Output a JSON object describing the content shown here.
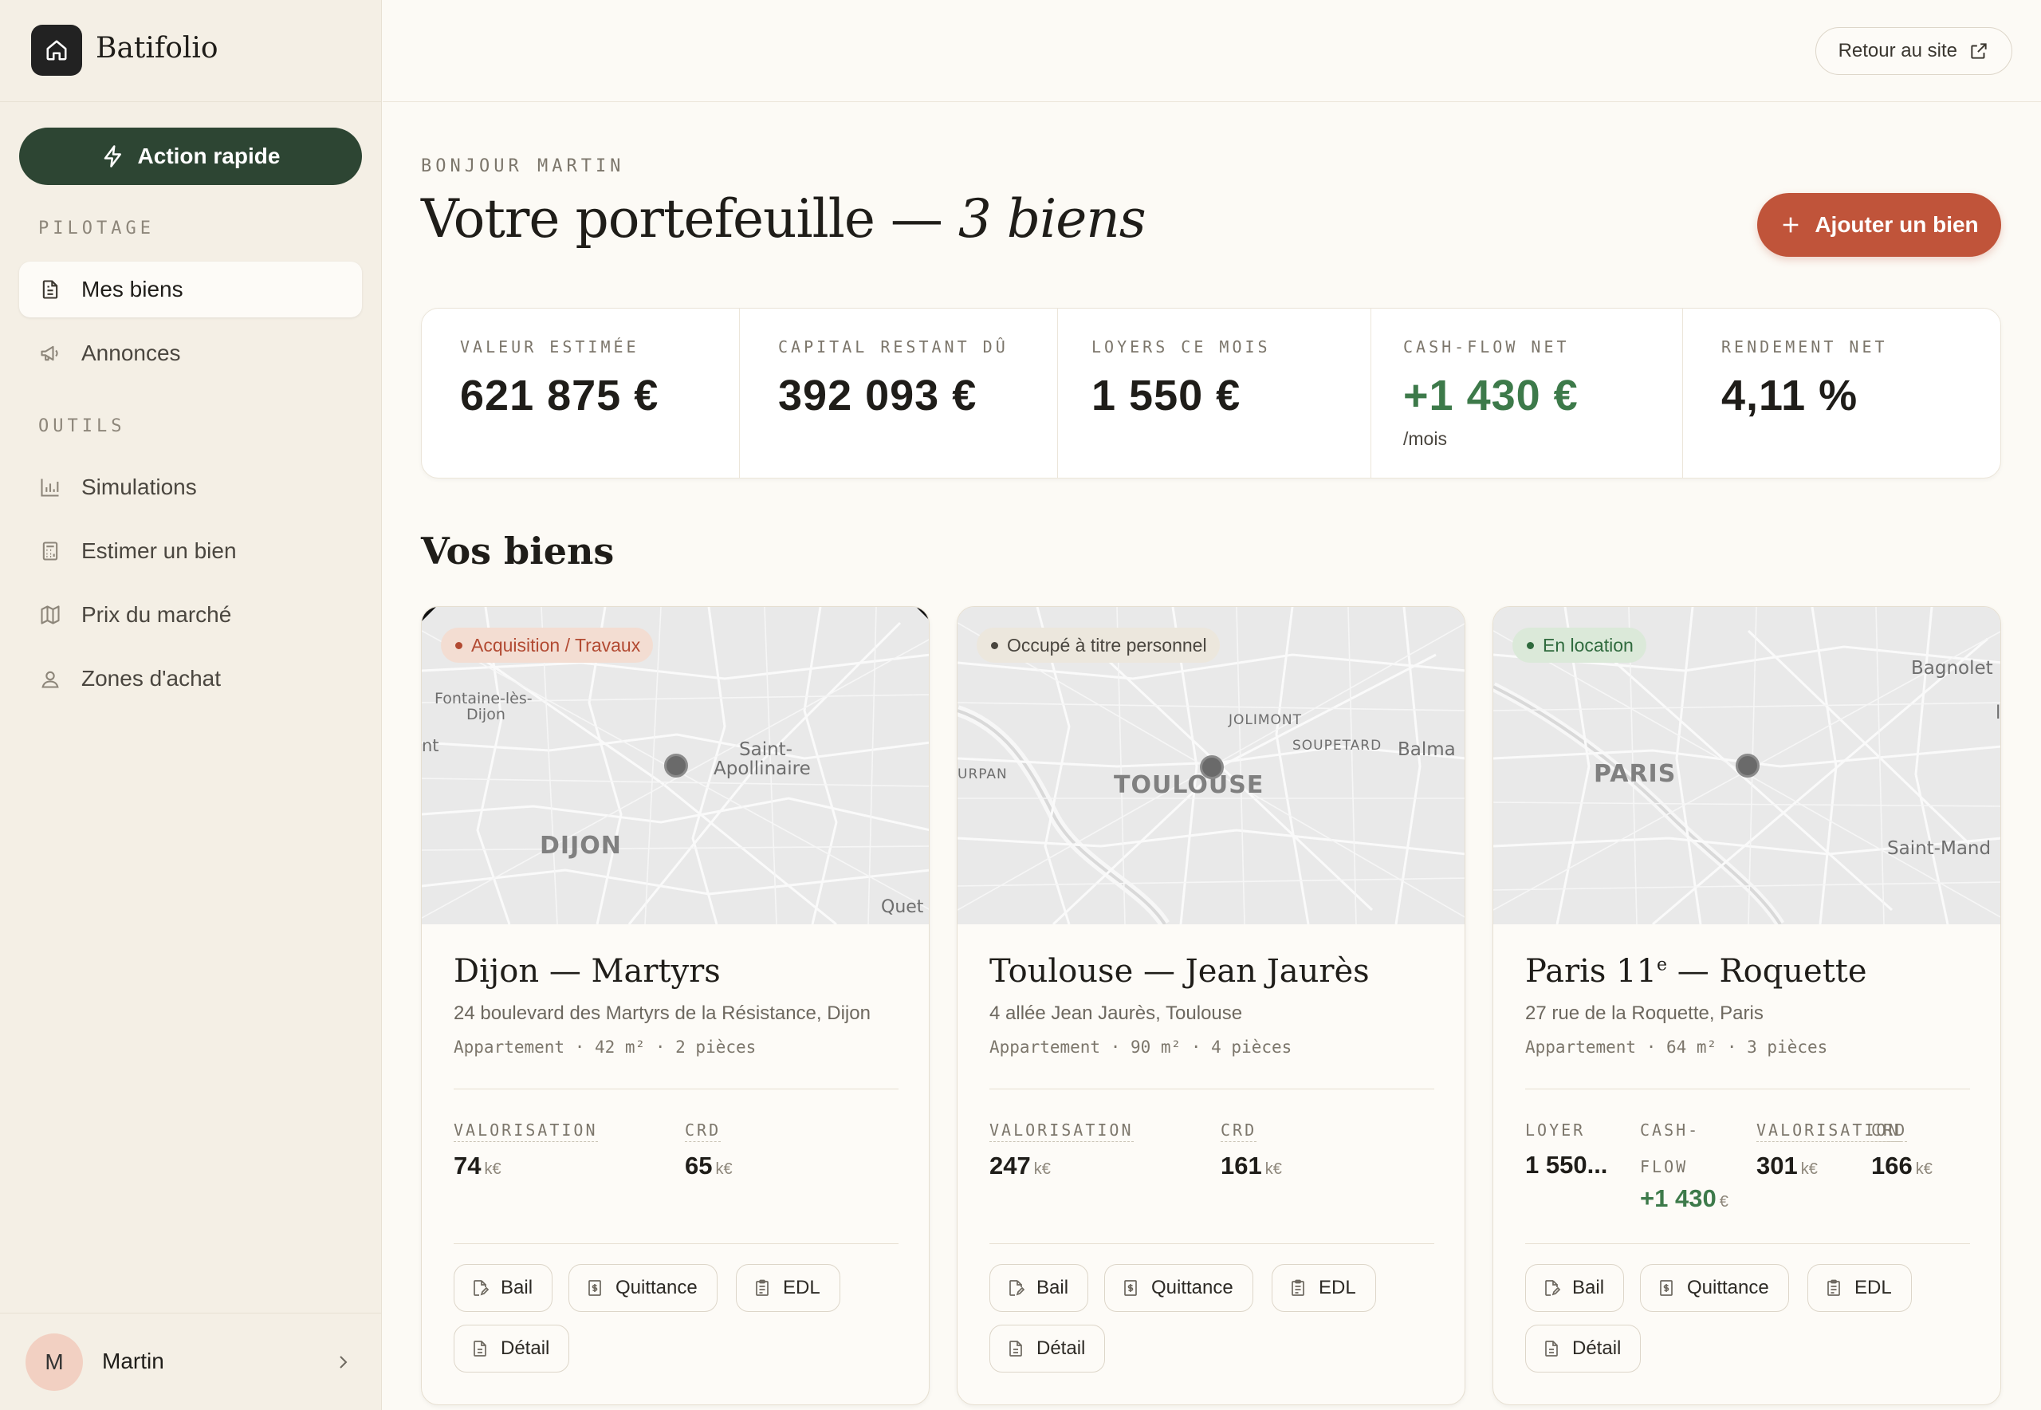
{
  "brand": {
    "name": "Batifolio"
  },
  "sidebar": {
    "quick_action": "Action rapide",
    "sections": [
      {
        "label": "PILOTAGE",
        "items": [
          {
            "label": "Mes biens",
            "icon": "document-icon",
            "active": true
          },
          {
            "label": "Annonces",
            "icon": "megaphone-icon"
          }
        ]
      },
      {
        "label": "OUTILS",
        "items": [
          {
            "label": "Simulations",
            "icon": "bar-chart-icon"
          },
          {
            "label": "Estimer un bien",
            "icon": "calculator-icon"
          },
          {
            "label": "Prix du marché",
            "icon": "map-icon"
          },
          {
            "label": "Zones d'achat",
            "icon": "user-pin-icon"
          }
        ]
      }
    ],
    "user": {
      "initial": "M",
      "name": "Martin"
    }
  },
  "topbar": {
    "back_label": "Retour au site"
  },
  "header": {
    "greeting": "BONJOUR MARTIN",
    "title": "Votre portefeuille —",
    "title_em": "3 biens",
    "add_label": "Ajouter un bien"
  },
  "kpis": [
    {
      "label": "VALEUR ESTIMÉE",
      "value": "621 875 €"
    },
    {
      "label": "CAPITAL RESTANT DÛ",
      "value": "392 093 €"
    },
    {
      "label": "LOYERS CE MOIS",
      "value": "1 550 €"
    },
    {
      "label": "CASH-FLOW NET",
      "value": "+1 430 €",
      "sub": "/mois"
    },
    {
      "label": "RENDEMENT NET",
      "value": "4,11 %"
    }
  ],
  "section_title": "Vos biens",
  "properties": [
    {
      "badge": "Acquisition / Travaux",
      "map_labels": {
        "city": "DIJON",
        "l1": "Fontaine-lès-",
        "l2": "Dijon",
        "l3": "Saint-",
        "l4": "Apollinaire",
        "l5": "nt",
        "l6": "Quet"
      },
      "title": "Dijon — Martyrs",
      "address": "24 boulevard des Martyrs de la Résistance, Dijon",
      "meta": "Appartement · 42 m² · 2 pièces",
      "stats": [
        {
          "label": "VALORISATION",
          "value": "74",
          "unit": "k€"
        },
        {
          "label": "CRD",
          "value": "65",
          "unit": "k€"
        }
      ],
      "docs": [
        "Bail",
        "Quittance",
        "EDL",
        "Détail"
      ]
    },
    {
      "badge": "Occupé à titre personnel",
      "map_labels": {
        "city": "TOULOUSE",
        "l1": "JOLIMONT",
        "l2": "SOUPETARD",
        "l3": "Balma",
        "l4": "URPAN"
      },
      "title": "Toulouse — Jean Jaurès",
      "address": "4 allée Jean Jaurès, Toulouse",
      "meta": "Appartement · 90 m² · 4 pièces",
      "stats": [
        {
          "label": "VALORISATION",
          "value": "247",
          "unit": "k€"
        },
        {
          "label": "CRD",
          "value": "161",
          "unit": "k€"
        }
      ],
      "docs": [
        "Bail",
        "Quittance",
        "EDL",
        "Détail"
      ]
    },
    {
      "badge": "En location",
      "map_labels": {
        "city": "PARIS",
        "l1": "Bagnolet",
        "l2": "Saint-Mand",
        "l3": "l"
      },
      "title": "Paris 11",
      "title_sup": "e",
      "title_rest": " — Roquette",
      "address": "27 rue de la Roquette, Paris",
      "meta": "Appartement · 64 m² · 3 pièces",
      "stats": [
        {
          "label": "LOYER",
          "value": "1 550..."
        },
        {
          "label": "CASH-",
          "label2": "FLOW",
          "value": "+1 430",
          "unit": "€"
        },
        {
          "label": "VALORISATION",
          "value": "301",
          "unit": "k€"
        },
        {
          "label": "CRD",
          "value": "166",
          "unit": "k€"
        }
      ],
      "docs": [
        "Bail",
        "Quittance",
        "EDL",
        "Détail"
      ]
    }
  ],
  "colors": {
    "accent_green": "#2d4533",
    "accent_orange": "#c0543a",
    "positive": "#3d7a4a",
    "background": "#fcfaf5"
  }
}
